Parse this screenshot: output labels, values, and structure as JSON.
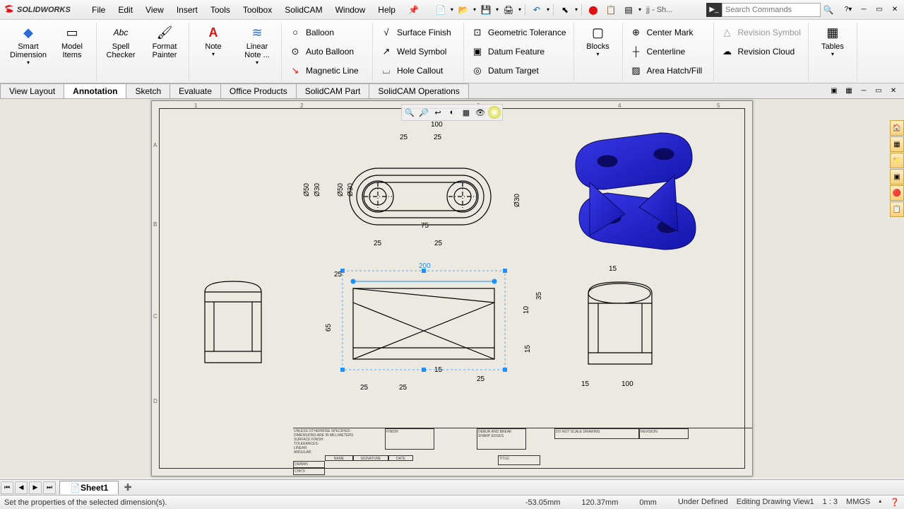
{
  "app": {
    "name": "SOLIDWORKS"
  },
  "menu": [
    "File",
    "Edit",
    "View",
    "Insert",
    "Tools",
    "Toolbox",
    "SolidCAM",
    "Window",
    "Help"
  ],
  "doc_name": "jj - Sh...",
  "search": {
    "placeholder": "Search Commands"
  },
  "ribbon": {
    "big": [
      {
        "label": "Smart Dimension",
        "icon": "◇",
        "color": "#2b6cd4"
      },
      {
        "label": "Model Items",
        "icon": "▭",
        "color": "#555"
      },
      {
        "label": "Spell Checker",
        "icon": "Abc",
        "color": "#333"
      },
      {
        "label": "Format Painter",
        "icon": "🖌",
        "color": "#c08020"
      },
      {
        "label": "Note",
        "icon": "A",
        "color": "#d11"
      },
      {
        "label": "Linear Note ...",
        "icon": "≋",
        "color": "#2b6cd4"
      },
      {
        "label": "Blocks",
        "icon": "□",
        "color": "#333"
      },
      {
        "label": "Tables",
        "icon": "▦",
        "color": "#333"
      }
    ],
    "col1": [
      {
        "label": "Balloon",
        "icon": "○"
      },
      {
        "label": "Auto Balloon",
        "icon": "⊙"
      },
      {
        "label": "Magnetic Line",
        "icon": "↘"
      }
    ],
    "col2": [
      {
        "label": "Surface Finish",
        "icon": "√"
      },
      {
        "label": "Weld Symbol",
        "icon": "↗"
      },
      {
        "label": "Hole Callout",
        "icon": "⌴"
      }
    ],
    "col3": [
      {
        "label": "Geometric Tolerance",
        "icon": "⊡"
      },
      {
        "label": "Datum Feature",
        "icon": "▣"
      },
      {
        "label": "Datum Target",
        "icon": "◎"
      }
    ],
    "col4": [
      {
        "label": "Center Mark",
        "icon": "⊕"
      },
      {
        "label": "Centerline",
        "icon": "┼"
      },
      {
        "label": "Area Hatch/Fill",
        "icon": "▨"
      }
    ],
    "col5": [
      {
        "label": "Revision Symbol",
        "icon": "△",
        "disabled": true
      },
      {
        "label": "Revision Cloud",
        "icon": "☁"
      }
    ]
  },
  "tabs": [
    "View Layout",
    "Annotation",
    "Sketch",
    "Evaluate",
    "Office Products",
    "SolidCAM Part",
    "SolidCAM Operations"
  ],
  "active_tab": "Annotation",
  "sheet_tab": "Sheet1",
  "status": {
    "hint": "Set the properties of the selected dimension(s).",
    "x": "-53.05mm",
    "y": "120.37mm",
    "z": "0mm",
    "state": "Under Defined",
    "mode": "Editing Drawing View1",
    "scale": "1 : 3",
    "units": "MMGS"
  },
  "dims": {
    "d100": "100",
    "d25a": "25",
    "d25b": "25",
    "d50": "Ø50",
    "d30": "Ø30",
    "d50b": "Ø50",
    "d30b": "Ø30",
    "d75": "75",
    "d25c": "25",
    "d25d": "25",
    "d200": "200",
    "d25e": "25",
    "d35": "35",
    "d10": "10",
    "d65": "65",
    "d15": "15",
    "d15b": "15",
    "d25f": "25",
    "d25g": "25",
    "d25h": "25",
    "d15c": "15",
    "d100b": "100",
    "d15d": "15"
  },
  "titleblock": {
    "note1": "UNLESS OTHERWISE SPECIFIED:",
    "note2": "DIMENSIONS ARE IN MILLIMETERS",
    "note3": "SURFACE FINISH:",
    "note4": "TOLERANCES:",
    "note5": "   LINEAR:",
    "note6": "   ANGULAR:",
    "finish": "FINISH:",
    "debur": "DEBUR AND BREAK SHARP EDGES",
    "dnsd": "DO NOT SCALE DRAWING",
    "rev": "REVISION",
    "name": "NAME",
    "sig": "SIGNATURE",
    "date": "DATE",
    "drawn": "DRAWN",
    "chkd": "CHK'D",
    "title": "TITLE:"
  }
}
